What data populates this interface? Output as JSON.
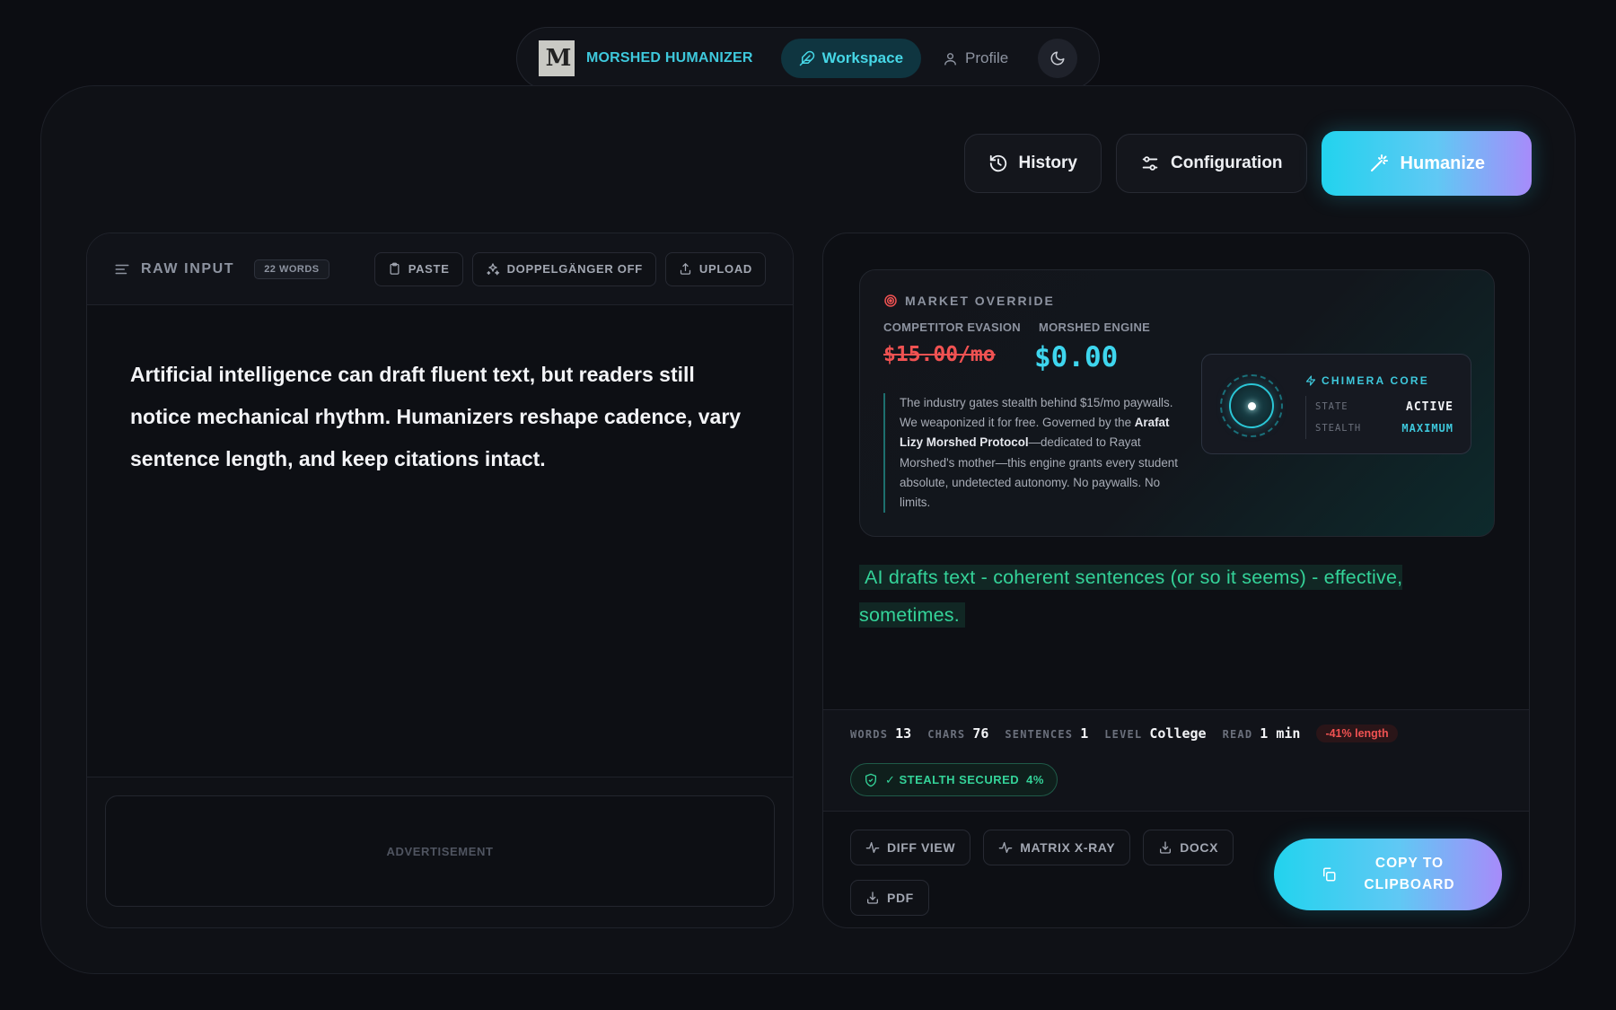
{
  "nav": {
    "brand": "MORSHED HUMANIZER",
    "workspace": "Workspace",
    "profile": "Profile"
  },
  "actions": {
    "history": "History",
    "configuration": "Configuration",
    "humanize": "Humanize"
  },
  "input": {
    "title": "RAW INPUT",
    "word_badge": "22 WORDS",
    "paste": "PASTE",
    "doppelganger": "DOPPELGÄNGER OFF",
    "upload": "UPLOAD",
    "text": "Artificial intelligence can draft fluent text, but readers still notice mechanical rhythm. Humanizers reshape cadence, vary sentence length, and keep citations intact.",
    "ad_label": "ADVERTISEMENT"
  },
  "market": {
    "title": "MARKET OVERRIDE",
    "competitor_label": "COMPETITOR EVASION",
    "engine_label": "MORSHED ENGINE",
    "competitor_price": "$15.00/mo",
    "engine_price": "$0.00",
    "desc_a": "The industry gates stealth behind $15/mo paywalls. We weaponized it for free. Governed by the ",
    "desc_protocol": "Arafat Lizy Morshed Protocol",
    "desc_b": "—dedicated to Rayat Morshed's mother—this engine grants every student absolute, undetected autonomy. No paywalls. No limits."
  },
  "core": {
    "title": "CHIMERA CORE",
    "state_label": "STATE",
    "state_value": "ACTIVE",
    "stealth_label": "STEALTH",
    "stealth_value": "MAXIMUM"
  },
  "output": {
    "text": "AI drafts text - coherent sentences (or so it seems) - effective, sometimes."
  },
  "stats": {
    "words_label": "WORDS",
    "words": "13",
    "chars_label": "CHARS",
    "chars": "76",
    "sentences_label": "SENTENCES",
    "sentences": "1",
    "level_label": "LEVEL",
    "level": "College",
    "read_label": "READ",
    "read": "1 min",
    "length_change": "-41% length",
    "stealth_status": "✓ STEALTH SECURED",
    "stealth_score": "4%"
  },
  "export": {
    "diff_view": "DIFF VIEW",
    "matrix_xray": "MATRIX X-RAY",
    "docx": "DOCX",
    "pdf": "PDF",
    "copy_line1": "COPY TO",
    "copy_line2": "CLIPBOARD"
  },
  "colors": {
    "accent": "#22d3ee",
    "accent_end": "#a78bfa",
    "success": "#34d399",
    "danger": "#f05252"
  },
  "icons": [
    "feather-icon",
    "user-icon",
    "moon-icon",
    "history-icon",
    "sliders-icon",
    "wand-icon",
    "menu-lines-icon",
    "clipboard-icon",
    "sparkles-icon",
    "upload-icon",
    "target-icon",
    "zap-icon",
    "shield-icon",
    "activity-icon",
    "download-icon",
    "copy-icon"
  ]
}
